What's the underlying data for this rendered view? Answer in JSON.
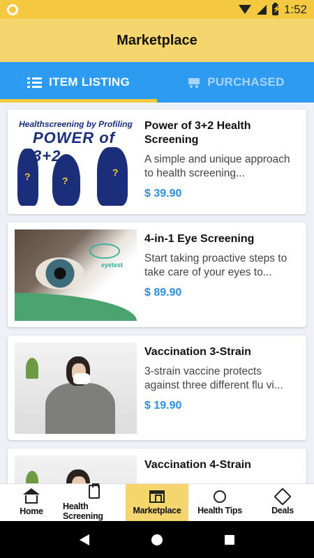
{
  "status_bar": {
    "time": "1:52"
  },
  "app_bar": {
    "title": "Marketplace"
  },
  "tabs": [
    {
      "label": "ITEM LISTING",
      "icon": "list-icon",
      "active": true
    },
    {
      "label": "PURCHASED",
      "icon": "cart-icon",
      "active": false
    }
  ],
  "items": [
    {
      "title": "Power of 3+2 Health Screening",
      "description": "A simple and unique approach to health screening...",
      "price": "$ 39.90",
      "image_text": {
        "line1": "Healthscreening by Profiling",
        "line2": "POWER of 3+2"
      }
    },
    {
      "title": "4-in-1 Eye Screening",
      "description": "Start taking proactive steps to take care of your eyes to...",
      "price": "$ 89.90",
      "image_text": {
        "logo": "eyetest"
      }
    },
    {
      "title": "Vaccination 3-Strain",
      "description": "3-strain vaccine protects against three different flu vi...",
      "price": "$ 19.90"
    },
    {
      "title": "Vaccination 4-Strain",
      "description": "",
      "price": ""
    }
  ],
  "bottom_nav": [
    {
      "label": "Home",
      "icon": "home-icon",
      "active": false
    },
    {
      "label": "Health Screening",
      "icon": "clipboard-icon",
      "active": false
    },
    {
      "label": "Marketplace",
      "icon": "shop-icon",
      "active": true
    },
    {
      "label": "Health Tips",
      "icon": "apple-icon",
      "active": false
    },
    {
      "label": "Deals",
      "icon": "tag-icon",
      "active": false
    }
  ],
  "colors": {
    "accent_yellow": "#f5d66e",
    "tab_blue": "#2d9bf0",
    "price_blue": "#2d8fe0"
  }
}
